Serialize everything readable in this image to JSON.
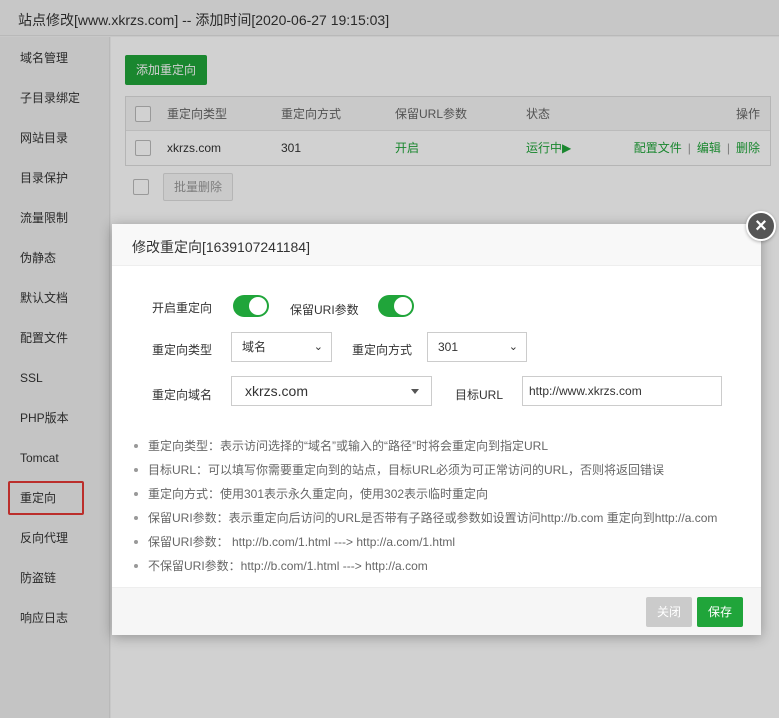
{
  "window": {
    "title": "站点修改[www.xkrzs.com] -- 添加时间[2020-06-27 19:15:03]"
  },
  "sidebar": {
    "items": [
      {
        "label": "域名管理"
      },
      {
        "label": "子目录绑定"
      },
      {
        "label": "网站目录"
      },
      {
        "label": "目录保护"
      },
      {
        "label": "流量限制"
      },
      {
        "label": "伪静态"
      },
      {
        "label": "默认文档"
      },
      {
        "label": "配置文件"
      },
      {
        "label": "SSL"
      },
      {
        "label": "PHP版本"
      },
      {
        "label": "Tomcat"
      },
      {
        "label": "重定向",
        "active": true
      },
      {
        "label": "反向代理"
      },
      {
        "label": "防盗链"
      },
      {
        "label": "响应日志"
      }
    ]
  },
  "main": {
    "add_button": "添加重定向",
    "table": {
      "headers": [
        "重定向类型",
        "重定向方式",
        "保留URL参数",
        "状态",
        "操作"
      ],
      "rows": [
        {
          "type": "xkrzs.com",
          "method": "301",
          "keep_params": "开启",
          "status": "运行中▶",
          "action_config": "配置文件",
          "action_edit": "编辑",
          "action_delete": "删除",
          "separator": "|"
        }
      ]
    },
    "bulk_delete": "批量删除"
  },
  "dialog": {
    "title": "修改重定向[1639107241184]",
    "close_glyph": "×",
    "enable_redirect_label": "开启重定向",
    "keep_uri_label": "保留URI参数",
    "redirect_type_label": "重定向类型",
    "redirect_type_value": "域名",
    "redirect_method_label": "重定向方式",
    "redirect_method_value": "301",
    "redirect_domain_label": "重定向域名",
    "redirect_domain_value": "xkrzs.com",
    "target_url_label": "目标URL",
    "target_url_value": "http://www.xkrzs.com",
    "tips": [
      "重定向类型：表示访问选择的“域名”或输入的“路径”时将会重定向到指定URL",
      "目标URL：可以填写你需要重定向到的站点，目标URL必须为可正常访问的URL，否则将返回错误",
      "重定向方式：使用301表示永久重定向，使用302表示临时重定向",
      "保留URI参数：表示重定向后访问的URL是否带有子路径或参数如设置访问http://b.com 重定向到http://a.com",
      "保留URI参数：  http://b.com/1.html ---> http://a.com/1.html",
      "不保留URI参数：http://b.com/1.html ---> http://a.com"
    ],
    "footer": {
      "close": "关闭",
      "save": "保存"
    }
  },
  "colors": {
    "accent": "#20a53a",
    "active_outline": "#e53935"
  }
}
